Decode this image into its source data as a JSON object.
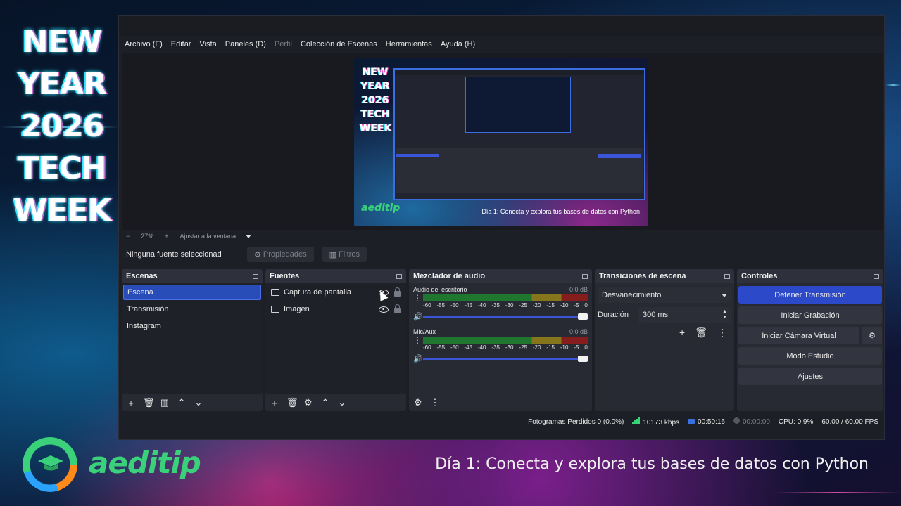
{
  "promo": {
    "title_lines": [
      "NEW",
      "YEAR",
      "2026",
      "TECH",
      "WEEK"
    ],
    "logo_text": "aeditip",
    "caption": "Día 1: Conecta y explora tus bases de datos con Python"
  },
  "menu": [
    "Archivo (F)",
    "Editar",
    "Vista",
    "Paneles (D)",
    "Perfil",
    "Colección de Escenas",
    "Herramientas",
    "Ayuda (H)"
  ],
  "preview": {
    "title_lines": [
      "NEW",
      "YEAR",
      "2026",
      "TECH",
      "WEEK"
    ],
    "logo_text": "aeditip",
    "caption": "Día 1: Conecta y explora tus bases de datos con Python"
  },
  "zoombar": {
    "minus": "−",
    "zoom": "27%",
    "plus": "+",
    "fit": "Ajustar a la ventana"
  },
  "context": {
    "selection": "Ninguna fuente seleccionad",
    "properties": "Propiedades",
    "filters": "Filtros"
  },
  "scenes": {
    "title": "Escenas",
    "items": [
      "Escena",
      "Transmisión",
      "Instagram"
    ],
    "selected_index": 0
  },
  "sources": {
    "title": "Fuentes",
    "items": [
      {
        "label": "Captura de pantalla",
        "icon": "monitor-icon"
      },
      {
        "label": "Imagen",
        "icon": "image-icon"
      }
    ]
  },
  "mixer": {
    "title": "Mezclador de audio",
    "scale": [
      "-60",
      "-55",
      "-50",
      "-45",
      "-40",
      "-35",
      "-30",
      "-25",
      "-20",
      "-15",
      "-10",
      "-5",
      "0"
    ],
    "channels": [
      {
        "name": "Audio del escritorio",
        "db": "0.0 dB"
      },
      {
        "name": "Mic/Aux",
        "db": "0.0 dB"
      }
    ]
  },
  "transitions": {
    "title": "Transiciones de escena",
    "selected": "Desvanecimiento",
    "duration_label": "Duración",
    "duration_value": "300 ms"
  },
  "controls": {
    "title": "Controles",
    "stop_stream": "Detener Transmisión",
    "start_recording": "Iniciar Grabación",
    "virtual_camera": "Iniciar Cámara Virtual",
    "studio_mode": "Modo Estudio",
    "settings": "Ajustes"
  },
  "status": {
    "dropped": "Fotogramas Perdidos 0 (0.0%)",
    "bitrate": "10173 kbps",
    "stream_time": "00:50:16",
    "rec_time": "00:00:00",
    "cpu": "CPU: 0.9%",
    "fps": "60.00 / 60.00 FPS"
  },
  "colors": {
    "accent": "#2b49c8",
    "meter_green": "#1f7a2e",
    "meter_yellow": "#8a7a1a",
    "meter_red": "#8b1c1c",
    "logo_green": "#3ad17a"
  }
}
